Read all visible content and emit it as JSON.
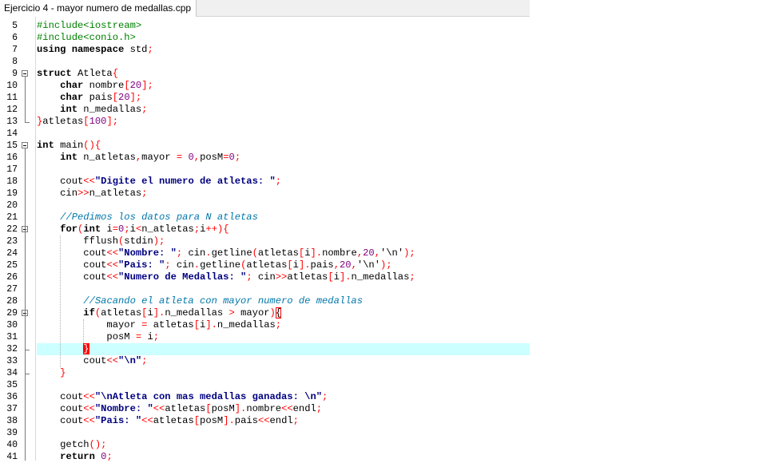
{
  "tab": {
    "label": "Ejercicio 4 - mayor numero de medallas.cpp"
  },
  "colors": {
    "keyword": "#000000",
    "preprocessor": "#008000",
    "string": "#000080",
    "number": "#800080",
    "comment": "#0077aa",
    "operator": "#ff0000",
    "current_line": "#ccffff",
    "bracket_match": "#ff0000"
  },
  "editor": {
    "current_line": 32,
    "lines": [
      {
        "n": "5",
        "toks": [
          [
            "pp",
            "#include<iostream>"
          ]
        ]
      },
      {
        "n": "6",
        "toks": [
          [
            "pp",
            "#include<conio.h>"
          ]
        ]
      },
      {
        "n": "7",
        "toks": [
          [
            "kw",
            "using namespace"
          ],
          [
            "txt",
            " std"
          ],
          [
            "op",
            ";"
          ]
        ]
      },
      {
        "n": "8",
        "toks": []
      },
      {
        "n": "9",
        "toks": [
          [
            "kw",
            "struct"
          ],
          [
            "txt",
            " Atleta"
          ],
          [
            "op",
            "{"
          ]
        ]
      },
      {
        "n": "10",
        "toks": [
          [
            "txt",
            "    "
          ],
          [
            "kw",
            "char"
          ],
          [
            "txt",
            " nombre"
          ],
          [
            "op",
            "["
          ],
          [
            "num",
            "20"
          ],
          [
            "op",
            "];"
          ]
        ]
      },
      {
        "n": "11",
        "toks": [
          [
            "txt",
            "    "
          ],
          [
            "kw",
            "char"
          ],
          [
            "txt",
            " pais"
          ],
          [
            "op",
            "["
          ],
          [
            "num",
            "20"
          ],
          [
            "op",
            "];"
          ]
        ]
      },
      {
        "n": "12",
        "toks": [
          [
            "txt",
            "    "
          ],
          [
            "kw",
            "int"
          ],
          [
            "txt",
            " n_medallas"
          ],
          [
            "op",
            ";"
          ]
        ]
      },
      {
        "n": "13",
        "toks": [
          [
            "op",
            "}"
          ],
          [
            "txt",
            "atletas"
          ],
          [
            "op",
            "["
          ],
          [
            "num",
            "100"
          ],
          [
            "op",
            "];"
          ]
        ]
      },
      {
        "n": "14",
        "toks": []
      },
      {
        "n": "15",
        "toks": [
          [
            "kw",
            "int"
          ],
          [
            "txt",
            " main"
          ],
          [
            "op",
            "(){"
          ]
        ]
      },
      {
        "n": "16",
        "toks": [
          [
            "txt",
            "    "
          ],
          [
            "kw",
            "int"
          ],
          [
            "txt",
            " n_atletas"
          ],
          [
            "op",
            ","
          ],
          [
            "txt",
            "mayor "
          ],
          [
            "op",
            "="
          ],
          [
            "txt",
            " "
          ],
          [
            "num",
            "0"
          ],
          [
            "op",
            ","
          ],
          [
            "txt",
            "posM"
          ],
          [
            "op",
            "="
          ],
          [
            "num",
            "0"
          ],
          [
            "op",
            ";"
          ]
        ]
      },
      {
        "n": "17",
        "toks": []
      },
      {
        "n": "18",
        "toks": [
          [
            "txt",
            "    cout"
          ],
          [
            "op",
            "<<"
          ],
          [
            "str",
            "\"Digite el numero de atletas: \""
          ],
          [
            "op",
            ";"
          ]
        ]
      },
      {
        "n": "19",
        "toks": [
          [
            "txt",
            "    cin"
          ],
          [
            "op",
            ">>"
          ],
          [
            "txt",
            "n_atletas"
          ],
          [
            "op",
            ";"
          ]
        ]
      },
      {
        "n": "20",
        "toks": []
      },
      {
        "n": "21",
        "toks": [
          [
            "txt",
            "    "
          ],
          [
            "cmt",
            "//Pedimos los datos para N atletas"
          ]
        ]
      },
      {
        "n": "22",
        "toks": [
          [
            "txt",
            "    "
          ],
          [
            "kw",
            "for"
          ],
          [
            "op",
            "("
          ],
          [
            "kw",
            "int"
          ],
          [
            "txt",
            " i"
          ],
          [
            "op",
            "="
          ],
          [
            "num",
            "0"
          ],
          [
            "op",
            ";"
          ],
          [
            "txt",
            "i"
          ],
          [
            "op",
            "<"
          ],
          [
            "txt",
            "n_atletas"
          ],
          [
            "op",
            ";"
          ],
          [
            "txt",
            "i"
          ],
          [
            "op",
            "++){"
          ]
        ]
      },
      {
        "n": "23",
        "toks": [
          [
            "txt",
            "        fflush"
          ],
          [
            "op",
            "("
          ],
          [
            "txt",
            "stdin"
          ],
          [
            "op",
            ");"
          ]
        ]
      },
      {
        "n": "24",
        "toks": [
          [
            "txt",
            "        cout"
          ],
          [
            "op",
            "<<"
          ],
          [
            "str",
            "\"Nombre: \""
          ],
          [
            "op",
            ";"
          ],
          [
            "txt",
            " cin"
          ],
          [
            "op",
            "."
          ],
          [
            "txt",
            "getline"
          ],
          [
            "op",
            "("
          ],
          [
            "txt",
            "atletas"
          ],
          [
            "op",
            "["
          ],
          [
            "txt",
            "i"
          ],
          [
            "op",
            "]."
          ],
          [
            "txt",
            "nombre"
          ],
          [
            "op",
            ","
          ],
          [
            "num",
            "20"
          ],
          [
            "op",
            ","
          ],
          [
            "txt",
            "'\\n'"
          ],
          [
            "op",
            ");"
          ]
        ]
      },
      {
        "n": "25",
        "toks": [
          [
            "txt",
            "        cout"
          ],
          [
            "op",
            "<<"
          ],
          [
            "str",
            "\"Pais: \""
          ],
          [
            "op",
            ";"
          ],
          [
            "txt",
            " cin"
          ],
          [
            "op",
            "."
          ],
          [
            "txt",
            "getline"
          ],
          [
            "op",
            "("
          ],
          [
            "txt",
            "atletas"
          ],
          [
            "op",
            "["
          ],
          [
            "txt",
            "i"
          ],
          [
            "op",
            "]."
          ],
          [
            "txt",
            "pais"
          ],
          [
            "op",
            ","
          ],
          [
            "num",
            "20"
          ],
          [
            "op",
            ","
          ],
          [
            "txt",
            "'\\n'"
          ],
          [
            "op",
            ");"
          ]
        ]
      },
      {
        "n": "26",
        "toks": [
          [
            "txt",
            "        cout"
          ],
          [
            "op",
            "<<"
          ],
          [
            "str",
            "\"Numero de Medallas: \""
          ],
          [
            "op",
            ";"
          ],
          [
            "txt",
            " cin"
          ],
          [
            "op",
            ">>"
          ],
          [
            "txt",
            "atletas"
          ],
          [
            "op",
            "["
          ],
          [
            "txt",
            "i"
          ],
          [
            "op",
            "]."
          ],
          [
            "txt",
            "n_medallas"
          ],
          [
            "op",
            ";"
          ]
        ]
      },
      {
        "n": "27",
        "toks": []
      },
      {
        "n": "28",
        "toks": [
          [
            "txt",
            "        "
          ],
          [
            "cmt",
            "//Sacando el atleta con mayor numero de medallas"
          ]
        ]
      },
      {
        "n": "29",
        "toks": [
          [
            "txt",
            "        "
          ],
          [
            "kw",
            "if"
          ],
          [
            "op",
            "("
          ],
          [
            "txt",
            "atletas"
          ],
          [
            "op",
            "["
          ],
          [
            "txt",
            "i"
          ],
          [
            "op",
            "]."
          ],
          [
            "txt",
            "n_medallas "
          ],
          [
            "op",
            ">"
          ],
          [
            "txt",
            " mayor"
          ],
          [
            "op",
            ")"
          ],
          [
            "brkbox",
            "{"
          ]
        ]
      },
      {
        "n": "30",
        "toks": [
          [
            "txt",
            "            mayor "
          ],
          [
            "op",
            "="
          ],
          [
            "txt",
            " atletas"
          ],
          [
            "op",
            "["
          ],
          [
            "txt",
            "i"
          ],
          [
            "op",
            "]."
          ],
          [
            "txt",
            "n_medallas"
          ],
          [
            "op",
            ";"
          ]
        ]
      },
      {
        "n": "31",
        "toks": [
          [
            "txt",
            "            posM "
          ],
          [
            "op",
            "="
          ],
          [
            "txt",
            " i"
          ],
          [
            "op",
            ";"
          ]
        ]
      },
      {
        "n": "32",
        "toks": [
          [
            "txt",
            "        "
          ],
          [
            "brk",
            "}"
          ]
        ]
      },
      {
        "n": "33",
        "toks": [
          [
            "txt",
            "        cout"
          ],
          [
            "op",
            "<<"
          ],
          [
            "str",
            "\"\\n\""
          ],
          [
            "op",
            ";"
          ]
        ]
      },
      {
        "n": "34",
        "toks": [
          [
            "txt",
            "    "
          ],
          [
            "op",
            "}"
          ]
        ]
      },
      {
        "n": "35",
        "toks": []
      },
      {
        "n": "36",
        "toks": [
          [
            "txt",
            "    cout"
          ],
          [
            "op",
            "<<"
          ],
          [
            "str",
            "\"\\nAtleta con mas medallas ganadas: \\n\""
          ],
          [
            "op",
            ";"
          ]
        ]
      },
      {
        "n": "37",
        "toks": [
          [
            "txt",
            "    cout"
          ],
          [
            "op",
            "<<"
          ],
          [
            "str",
            "\"Nombre: \""
          ],
          [
            "op",
            "<<"
          ],
          [
            "txt",
            "atletas"
          ],
          [
            "op",
            "["
          ],
          [
            "txt",
            "posM"
          ],
          [
            "op",
            "]."
          ],
          [
            "txt",
            "nombre"
          ],
          [
            "op",
            "<<"
          ],
          [
            "txt",
            "endl"
          ],
          [
            "op",
            ";"
          ]
        ]
      },
      {
        "n": "38",
        "toks": [
          [
            "txt",
            "    cout"
          ],
          [
            "op",
            "<<"
          ],
          [
            "str",
            "\"Pais: \""
          ],
          [
            "op",
            "<<"
          ],
          [
            "txt",
            "atletas"
          ],
          [
            "op",
            "["
          ],
          [
            "txt",
            "posM"
          ],
          [
            "op",
            "]."
          ],
          [
            "txt",
            "pais"
          ],
          [
            "op",
            "<<"
          ],
          [
            "txt",
            "endl"
          ],
          [
            "op",
            ";"
          ]
        ]
      },
      {
        "n": "39",
        "toks": []
      },
      {
        "n": "40",
        "toks": [
          [
            "txt",
            "    getch"
          ],
          [
            "op",
            "();"
          ]
        ]
      },
      {
        "n": "41",
        "toks": [
          [
            "txt",
            "    "
          ],
          [
            "kw",
            "return"
          ],
          [
            "txt",
            " "
          ],
          [
            "num",
            "0"
          ],
          [
            "op",
            ";"
          ]
        ]
      }
    ]
  }
}
